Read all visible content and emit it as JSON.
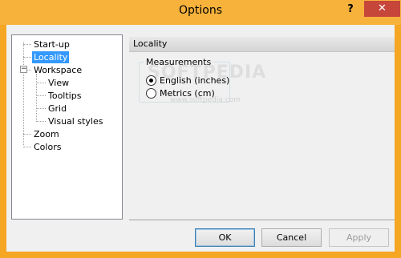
{
  "window": {
    "title": "Options",
    "help_label": "?",
    "close_label": "✕"
  },
  "tree": {
    "items": [
      {
        "label": "Start-up"
      },
      {
        "label": "Locality"
      },
      {
        "label": "Workspace",
        "expander": "−"
      },
      {
        "label": "View"
      },
      {
        "label": "Tooltips"
      },
      {
        "label": "Grid"
      },
      {
        "label": "Visual styles"
      },
      {
        "label": "Zoom"
      },
      {
        "label": "Colors"
      }
    ]
  },
  "panel": {
    "header": "Locality",
    "group": {
      "title": "Measurements",
      "options": [
        {
          "label": "English (inches)",
          "selected": true
        },
        {
          "label": "Metrics (cm)",
          "selected": false
        }
      ]
    }
  },
  "watermark": {
    "text": "SOFTPEDIA",
    "sub": "www.softpedia.com"
  },
  "buttons": {
    "ok": "OK",
    "cancel": "Cancel",
    "apply": "Apply"
  }
}
